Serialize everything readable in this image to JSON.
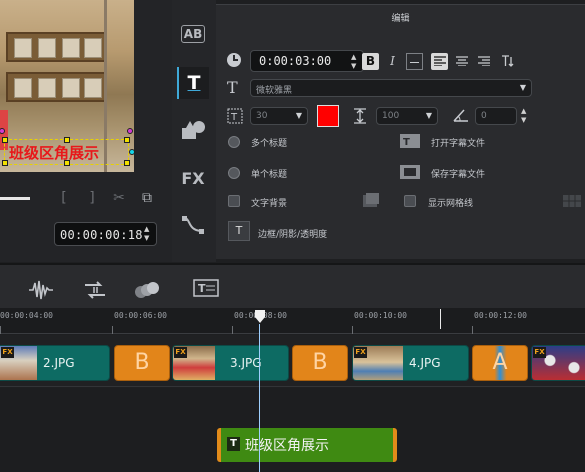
{
  "preview": {
    "overlay_text": "班级区角展示",
    "timecode": "00:00:00:18"
  },
  "side_tools": [
    "title-template-icon",
    "title-text-icon",
    "graphics-icon",
    "fx-icon",
    "motion-path-icon"
  ],
  "side_tool_labels": {
    "ab": "AB",
    "t": "T",
    "fx": "FX"
  },
  "editor": {
    "panel_title": "编辑",
    "duration": "0:00:03:00",
    "format": {
      "bold": "B",
      "italic": "I"
    },
    "font_icon": "T",
    "font_name": "微软雅黑",
    "font_size": "30",
    "text_color": "#ff0000",
    "line_spacing": "100",
    "rotation": "0",
    "multi_title": "多个标题",
    "single_title": "单个标题",
    "open_subtitle": "打开字幕文件",
    "save_subtitle": "保存字幕文件",
    "text_background": "文字背景",
    "show_grid": "显示网格线",
    "border_shadow": "边框/阴影/透明度"
  },
  "ruler": {
    "labels": [
      "00:00:04:00",
      "00:00:06:00",
      "00:00:08:00",
      "00:00:10:00",
      "00:00:12:00"
    ]
  },
  "tracks": {
    "video_clips": [
      {
        "name": "2.JPG",
        "fx": "FX"
      },
      {
        "name": "3.JPG",
        "fx": "FX"
      },
      {
        "name": "4.JPG",
        "fx": "FX"
      }
    ],
    "transitions": [
      "B",
      "B",
      "A"
    ],
    "title_clip": {
      "badge": "T",
      "name": "班级区角展示"
    }
  },
  "colors": {
    "accent": "#3fa9d8",
    "clip": "#0d6b63",
    "transition": "#e2851a",
    "title_clip": "#3f8a12"
  }
}
